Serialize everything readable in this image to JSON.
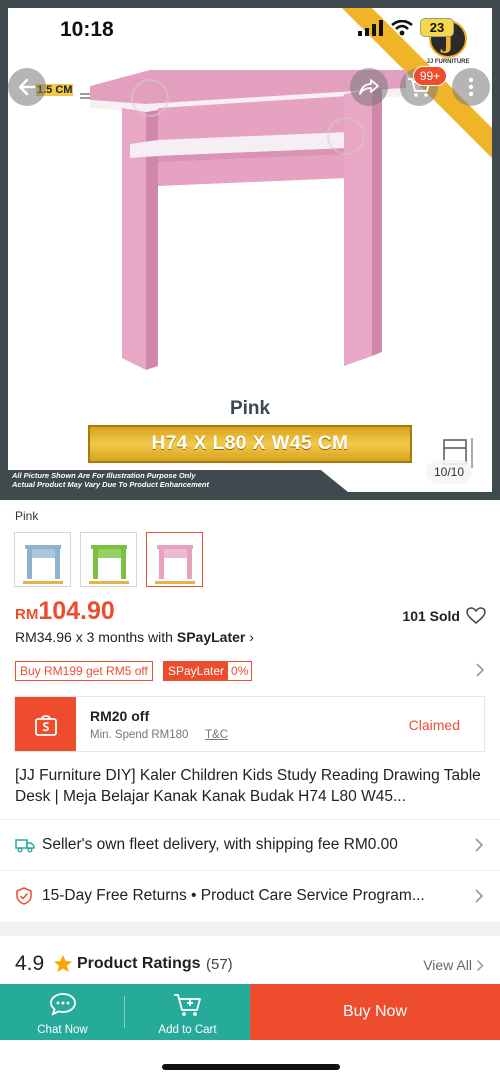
{
  "status_bar": {
    "time": "10:18",
    "battery": "23"
  },
  "gallery": {
    "color_caption": "Pink",
    "dimensions": "H74 X L80 X W45 CM",
    "thickness_label": "1.5 CM",
    "counter": "10/10",
    "disclaimer_line1": "All Picture Shown Are For Illustration Purpose Only",
    "disclaimer_line2": "Actual Product May Vary Due To Product Enhancement",
    "brand_text": "JJ FURNITURE",
    "brand_letter": "J",
    "cart_badge": "99+"
  },
  "variation": {
    "label": "Pink",
    "options": [
      {
        "name": "blue-option",
        "color": "#8fb3cf"
      },
      {
        "name": "green-option",
        "color": "#7bc043"
      },
      {
        "name": "pink-option",
        "color": "#e6a3bf",
        "selected": true
      }
    ]
  },
  "price": {
    "currency": "RM",
    "value": "104.90",
    "sold": "101 Sold",
    "installment_prefix": "RM34.96 x 3 months with ",
    "installment_brand": "SPayLater",
    "installment_suffix": " ›"
  },
  "promos": {
    "tag1": "Buy RM199 get RM5 off",
    "tag2_brand": "SPayLater",
    "tag2_value": "0%"
  },
  "voucher": {
    "title": "RM20 off",
    "min_spend": "Min. Spend RM180",
    "tc": "T&C",
    "status": "Claimed"
  },
  "product": {
    "title": "[JJ Furniture DIY] Kaler Children Kids Study Reading Drawing Table Desk | Meja Belajar Kanak Kanak Budak H74 L80 W45..."
  },
  "delivery": {
    "text": "Seller's own fleet delivery, with shipping fee RM0.00"
  },
  "returns": {
    "text": "15-Day Free Returns  •  Product Care Service Program..."
  },
  "ratings": {
    "score": "4.9",
    "label": "Product Ratings",
    "count": "(57)",
    "view_all": "View All"
  },
  "actions": {
    "chat": "Chat Now",
    "cart": "Add to Cart",
    "buy": "Buy Now"
  },
  "colors": {
    "accent": "#ee4d2d",
    "teal": "#26aa99",
    "desk_pink": "#e8a7c4",
    "gold": "#f0b429"
  }
}
